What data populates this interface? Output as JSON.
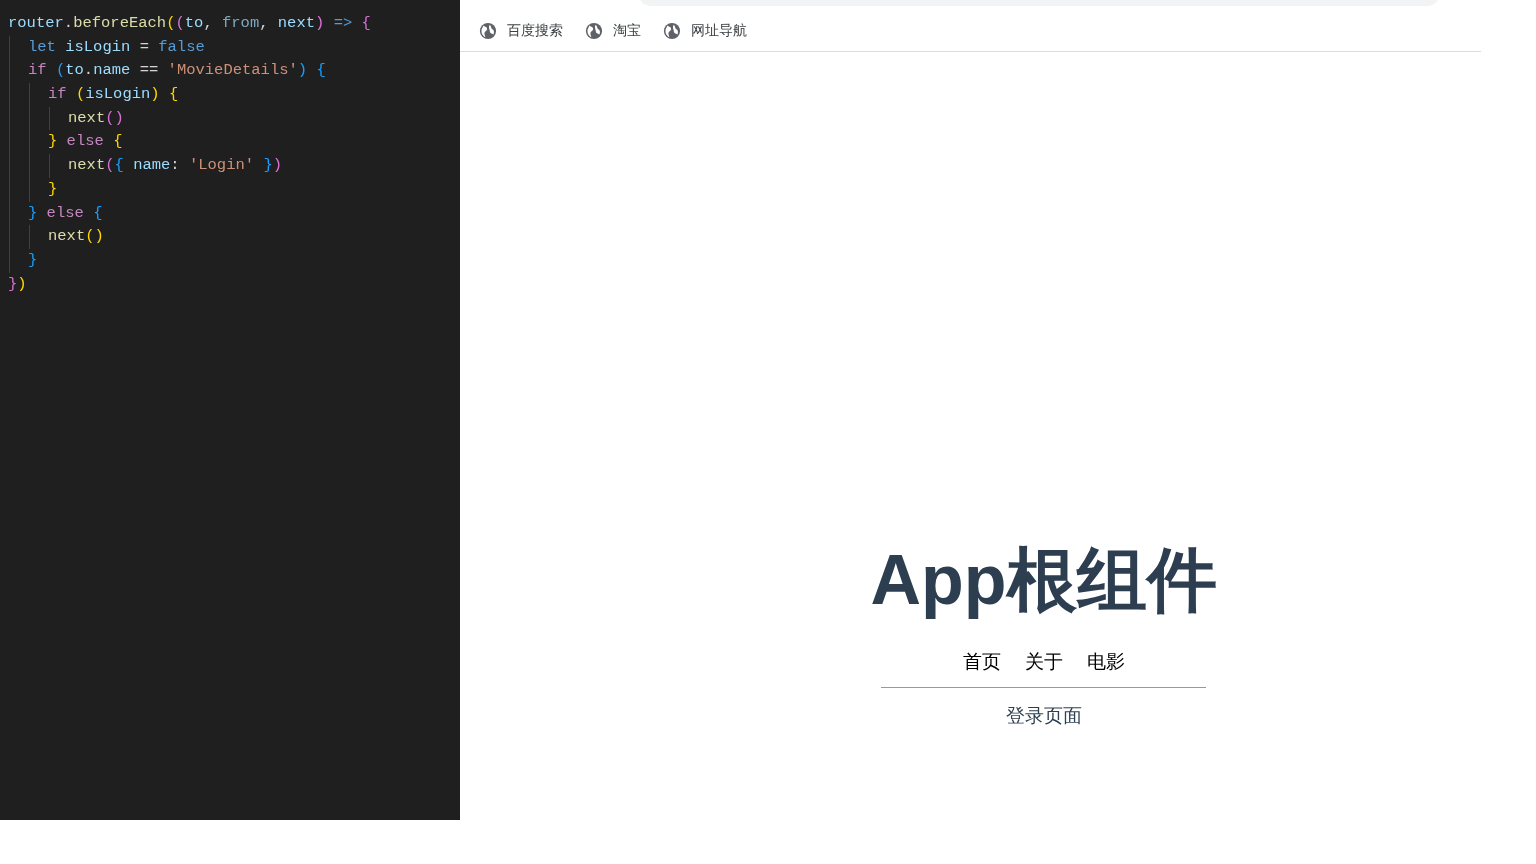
{
  "editor": {
    "lines": [
      {
        "tokens": [
          {
            "text": "router",
            "kind": "var"
          },
          {
            "text": ".",
            "kind": "op"
          },
          {
            "text": "beforeEach",
            "kind": "fn"
          },
          {
            "text": "(",
            "kind": "b1"
          },
          {
            "text": "(",
            "kind": "b2"
          },
          {
            "text": "to",
            "kind": "var"
          },
          {
            "text": ", ",
            "kind": "op"
          },
          {
            "text": "from",
            "kind": "dim"
          },
          {
            "text": ", ",
            "kind": "op"
          },
          {
            "text": "next",
            "kind": "var"
          },
          {
            "text": ") ",
            "kind": "b2"
          },
          {
            "text": "=> ",
            "kind": "kw"
          },
          {
            "text": "{",
            "kind": "b2"
          }
        ],
        "children": [
          {
            "tokens": [
              {
                "text": "let ",
                "kind": "kw"
              },
              {
                "text": "isLogin",
                "kind": "var"
              },
              {
                "text": " = ",
                "kind": "op"
              },
              {
                "text": "false",
                "kind": "kw"
              }
            ]
          },
          {
            "tokens": [
              {
                "text": "if ",
                "kind": "ctrl"
              },
              {
                "text": "(",
                "kind": "b3"
              },
              {
                "text": "to",
                "kind": "var"
              },
              {
                "text": ".",
                "kind": "op"
              },
              {
                "text": "name",
                "kind": "var"
              },
              {
                "text": " == ",
                "kind": "op"
              },
              {
                "text": "'MovieDetails'",
                "kind": "str"
              },
              {
                "text": ") ",
                "kind": "b3"
              },
              {
                "text": "{",
                "kind": "b3"
              }
            ],
            "children": [
              {
                "tokens": [
                  {
                    "text": "if ",
                    "kind": "ctrl"
                  },
                  {
                    "text": "(",
                    "kind": "b1"
                  },
                  {
                    "text": "isLogin",
                    "kind": "var"
                  },
                  {
                    "text": ") ",
                    "kind": "b1"
                  },
                  {
                    "text": "{",
                    "kind": "b1"
                  }
                ],
                "children": [
                  {
                    "tokens": [
                      {
                        "text": "next",
                        "kind": "fn"
                      },
                      {
                        "text": "()",
                        "kind": "b2"
                      }
                    ]
                  }
                ]
              },
              {
                "tokens": [
                  {
                    "text": "} ",
                    "kind": "b1"
                  },
                  {
                    "text": "else ",
                    "kind": "ctrl"
                  },
                  {
                    "text": "{",
                    "kind": "b1"
                  }
                ],
                "children": [
                  {
                    "tokens": [
                      {
                        "text": "next",
                        "kind": "fn"
                      },
                      {
                        "text": "(",
                        "kind": "b2"
                      },
                      {
                        "text": "{ ",
                        "kind": "b3"
                      },
                      {
                        "text": "name",
                        "kind": "var"
                      },
                      {
                        "text": ": ",
                        "kind": "op"
                      },
                      {
                        "text": "'Login' ",
                        "kind": "str"
                      },
                      {
                        "text": "}",
                        "kind": "b3"
                      },
                      {
                        "text": ")",
                        "kind": "b2"
                      }
                    ]
                  }
                ]
              },
              {
                "tokens": [
                  {
                    "text": "}",
                    "kind": "b1"
                  }
                ]
              }
            ]
          },
          {
            "tokens": [
              {
                "text": "} ",
                "kind": "b3"
              },
              {
                "text": "else ",
                "kind": "ctrl"
              },
              {
                "text": "{",
                "kind": "b3"
              }
            ],
            "children": [
              {
                "tokens": [
                  {
                    "text": "next",
                    "kind": "fn"
                  },
                  {
                    "text": "()",
                    "kind": "b1"
                  }
                ]
              }
            ]
          },
          {
            "tokens": [
              {
                "text": "}",
                "kind": "b3"
              }
            ]
          }
        ]
      },
      {
        "tokens": [
          {
            "text": "}",
            "kind": "b2"
          },
          {
            "text": ")",
            "kind": "b1"
          }
        ]
      }
    ]
  },
  "bookmarks": [
    {
      "label": "百度搜索"
    },
    {
      "label": "淘宝"
    },
    {
      "label": "网址导航"
    }
  ],
  "app": {
    "title": "App根组件",
    "nav": [
      {
        "label": "首页"
      },
      {
        "label": "关于"
      },
      {
        "label": "电影"
      }
    ],
    "content": "登录页面"
  }
}
